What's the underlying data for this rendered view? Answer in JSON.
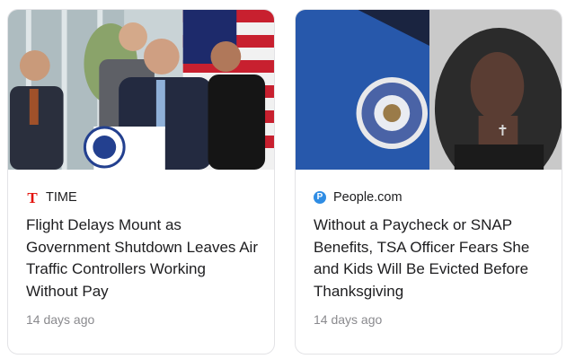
{
  "cards": [
    {
      "source": "TIME",
      "source_icon": "time-logo-icon",
      "brand_color": "#e3120b",
      "headline": "Flight Delays Mount as Government Shutdown Leaves Air Traffic Controllers Working Without Pay",
      "age": "14 days ago"
    },
    {
      "source": "People.com",
      "source_icon": "people-logo-icon",
      "brand_color": "#2f8de4",
      "headline": "Without a Paycheck or SNAP Benefits, TSA Officer Fears She and Kids Will Be Evicted Before Thanksgiving",
      "age": "14 days ago"
    }
  ],
  "ui": {
    "time_icon_glyph": "T",
    "people_icon_glyph": "P"
  }
}
